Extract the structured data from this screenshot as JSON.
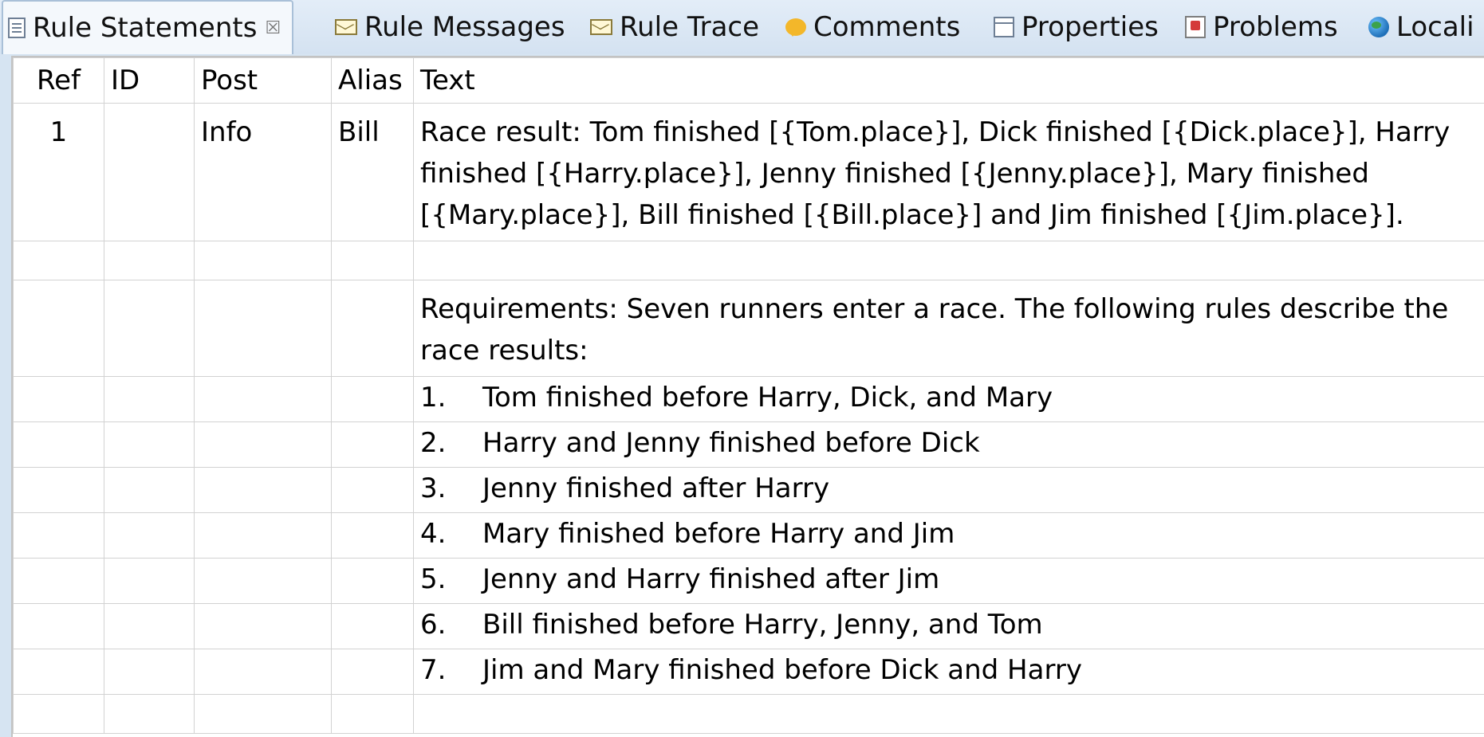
{
  "tabs": [
    {
      "label": "Rule Statements",
      "icon": "document-icon",
      "active": true
    },
    {
      "label": "Rule Messages",
      "icon": "mail-icon"
    },
    {
      "label": "Rule Trace",
      "icon": "mail-icon"
    },
    {
      "label": "Comments",
      "icon": "comment-bubble-icon"
    },
    {
      "label": "Properties",
      "icon": "properties-icon"
    },
    {
      "label": "Problems",
      "icon": "problems-icon"
    },
    {
      "label": "Locali",
      "icon": "globe-icon"
    }
  ],
  "close_glyph": "☒",
  "table": {
    "headers": {
      "ref": "Ref",
      "id": "ID",
      "post": "Post",
      "alias": "Alias",
      "text": "Text"
    },
    "row1": {
      "ref": "1",
      "id": "",
      "post": "Info",
      "alias": "Bill",
      "text_lines": [
        "Race result: Tom finished [{Tom.place}], Dick finished [{Dick.place}], Harry",
        "finished [{Harry.place}], Jenny finished [{Jenny.place}], Mary finished",
        "[{Mary.place}], Bill finished [{Bill.place}] and Jim finished [{Jim.place}]."
      ]
    },
    "requirements_lines": [
      "Requirements: Seven runners enter a race. The following rules describe the",
      "race results:"
    ],
    "rules": [
      {
        "num": "1.",
        "text": "Tom finished before Harry, Dick, and Mary"
      },
      {
        "num": "2.",
        "text": "Harry and Jenny finished before Dick"
      },
      {
        "num": "3.",
        "text": "Jenny finished after Harry"
      },
      {
        "num": "4.",
        "text": "Mary finished before Harry and Jim"
      },
      {
        "num": "5.",
        "text": "Jenny and Harry finished after Jim"
      },
      {
        "num": "6.",
        "text": "Bill finished before Harry, Jenny, and Tom"
      },
      {
        "num": "7.",
        "text": "Jim and Mary finished before Dick and Harry"
      }
    ]
  }
}
